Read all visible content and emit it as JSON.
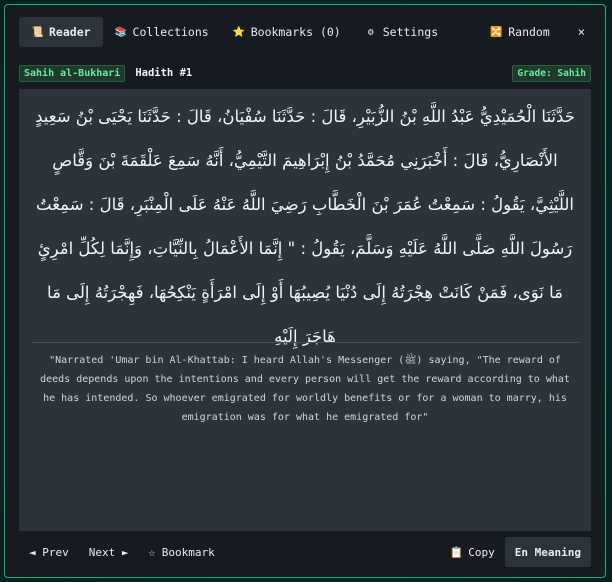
{
  "tabs": [
    {
      "label": "Reader",
      "icon": "scroll-icon",
      "glyph": "📜",
      "active": true
    },
    {
      "label": "Collections",
      "icon": "books-icon",
      "glyph": "📚",
      "active": false
    },
    {
      "label": "Bookmarks (0)",
      "icon": "star-icon",
      "glyph": "⭐",
      "active": false
    },
    {
      "label": "Settings",
      "icon": "gear-icon",
      "glyph": "⚙",
      "active": false
    }
  ],
  "random": {
    "label": "Random",
    "glyph": "🔀",
    "icon": "shuffle-icon"
  },
  "close": {
    "glyph": "×",
    "icon": "close-icon"
  },
  "meta": {
    "collection": "Sahih al-Bukhari",
    "hadith_number": "Hadith #1",
    "grade": "Grade: Sahih"
  },
  "arabic_text": "حَدَّثَنَا الْحُمَيْدِيُّ عَبْدُ اللَّهِ بْنُ الزُّبَيْرِ، قَالَ : حَدَّثَنَا سُفْيَانُ، قَالَ : حَدَّثَنَا يَحْيَى بْنُ سَعِيدٍ الأَنْصَارِيُّ، قَالَ : أَخْبَرَنِي مُحَمَّدُ بْنُ إِبْرَاهِيمَ التَّيْمِيُّ، أَنَّهُ سَمِعَ عَلْقَمَةَ بْنَ وَقَّاصٍ اللَّيْثِيَّ، يَقُولُ : سَمِعْتُ عُمَرَ بْنَ الْخَطَّابِ رَضِيَ اللَّهُ عَنْهُ عَلَى الْمِنْبَرِ، قَالَ : سَمِعْتُ رَسُولَ اللَّهِ صَلَّى اللَّهُ عَلَيْهِ وَسَلَّمَ، يَقُولُ : \" إِنَّمَا الأَعْمَالُ بِالنِّيَّاتِ، وَإِنَّمَا لِكُلِّ امْرِئٍ مَا نَوَى، فَمَنْ كَانَتْ هِجْرَتُهُ إِلَى دُنْيَا يُصِيبُهَا أَوْ إِلَى امْرَأَةٍ يَنْكِحُهَا، فَهِجْرَتُهُ إِلَى مَا هَاجَرَ إِلَيْهِ",
  "translation": "\"Narrated 'Umar bin Al-Khattab: I heard Allah's Messenger (ﷺ) saying, \"The reward of deeds depends upon the intentions and every person will get the reward according to what he has intended. So whoever emigrated for worldly benefits or for a woman to marry, his emigration was for what he emigrated for\"",
  "footer": {
    "prev": "◄ Prev",
    "next": "Next ►",
    "bookmark": "☆ Bookmark",
    "copy_icon": "📋",
    "copy": "Copy",
    "meaning": "En Meaning"
  }
}
